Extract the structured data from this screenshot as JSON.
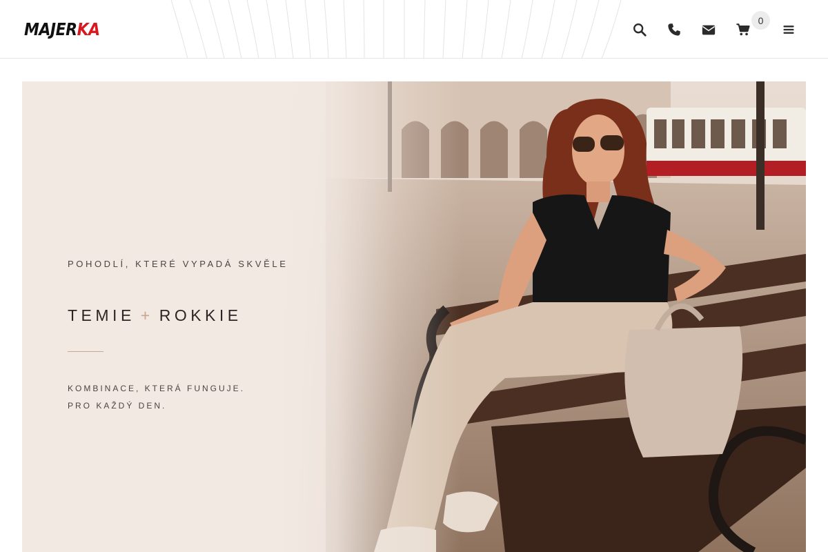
{
  "header": {
    "logo": {
      "prefix": "MAJER",
      "accent": "KA"
    },
    "icons": [
      {
        "name": "search-icon",
        "label": "Hledat"
      },
      {
        "name": "phone-icon",
        "label": "Telefon"
      },
      {
        "name": "mail-icon",
        "label": "E-mail"
      },
      {
        "name": "cart-icon",
        "label": "Košík"
      },
      {
        "name": "menu-icon",
        "label": "Menu"
      }
    ],
    "cart_count": "0",
    "icon_color": "#2b2b2b"
  },
  "hero": {
    "eyebrow": "POHODLÍ, KTERÉ VYPADÁ SKVĚLE",
    "title_left": "TEMIE",
    "title_plus": "+",
    "title_right": "ROKKIE",
    "line1": "KOMBINACE, KTERÁ FUNGUJE.",
    "line2": "PRO KAŽDÝ DEN.",
    "accent_color": "#c9a48f"
  }
}
